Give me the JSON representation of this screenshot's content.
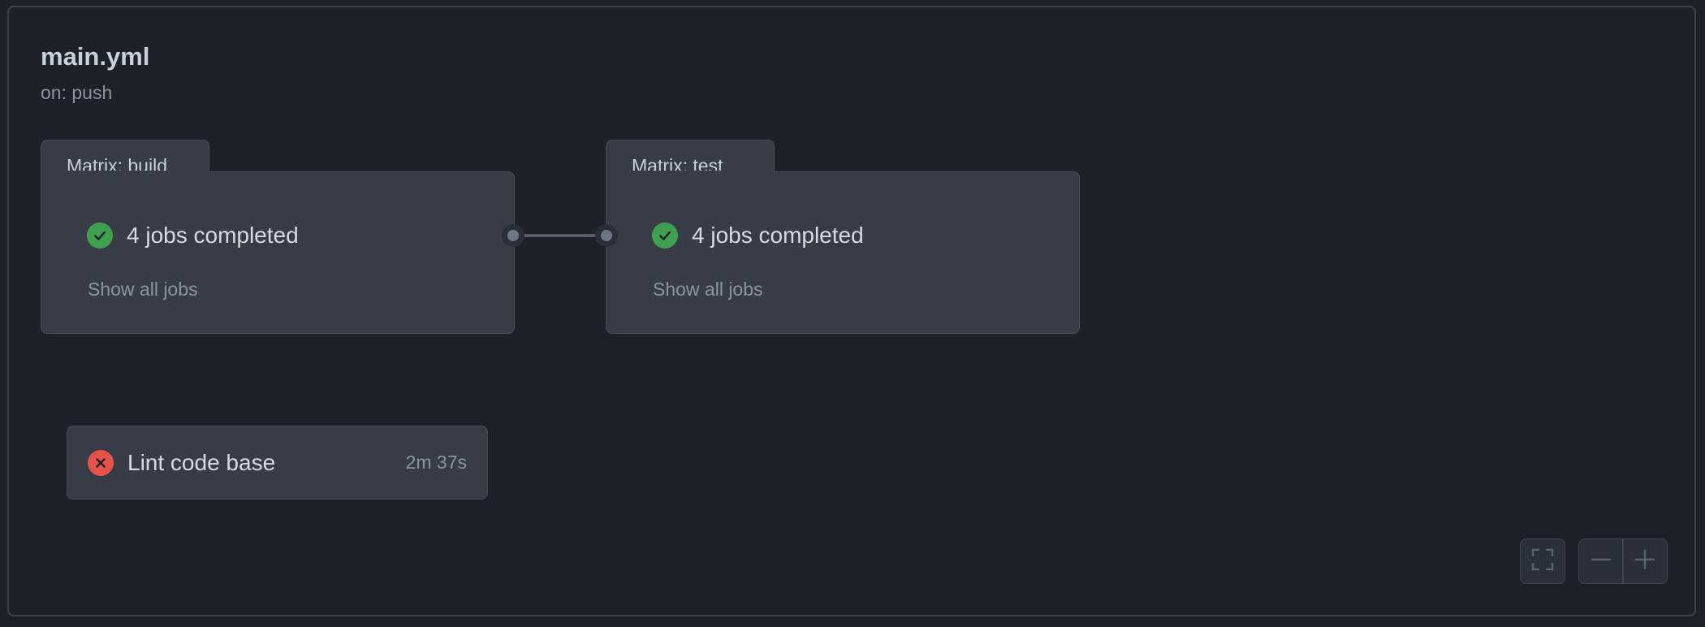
{
  "workflow": {
    "title": "main.yml",
    "trigger": "on: push"
  },
  "matrices": [
    {
      "label": "Matrix: build",
      "status_icon": "check-circle-icon",
      "status_text": "4 jobs completed",
      "link": "Show all jobs"
    },
    {
      "label": "Matrix: test",
      "status_icon": "check-circle-icon",
      "status_text": "4 jobs completed",
      "link": "Show all jobs"
    }
  ],
  "jobs": [
    {
      "name": "Lint code base",
      "duration": "2m 37s",
      "status_icon": "x-circle-icon"
    }
  ],
  "controls": {
    "fullscreen_icon": "fullscreen-icon",
    "zoom_out_icon": "minus-icon",
    "zoom_in_icon": "plus-icon"
  },
  "colors": {
    "background": "#1f2128",
    "card": "#373c46",
    "success": "#3fa14f",
    "failure": "#e5534b"
  }
}
